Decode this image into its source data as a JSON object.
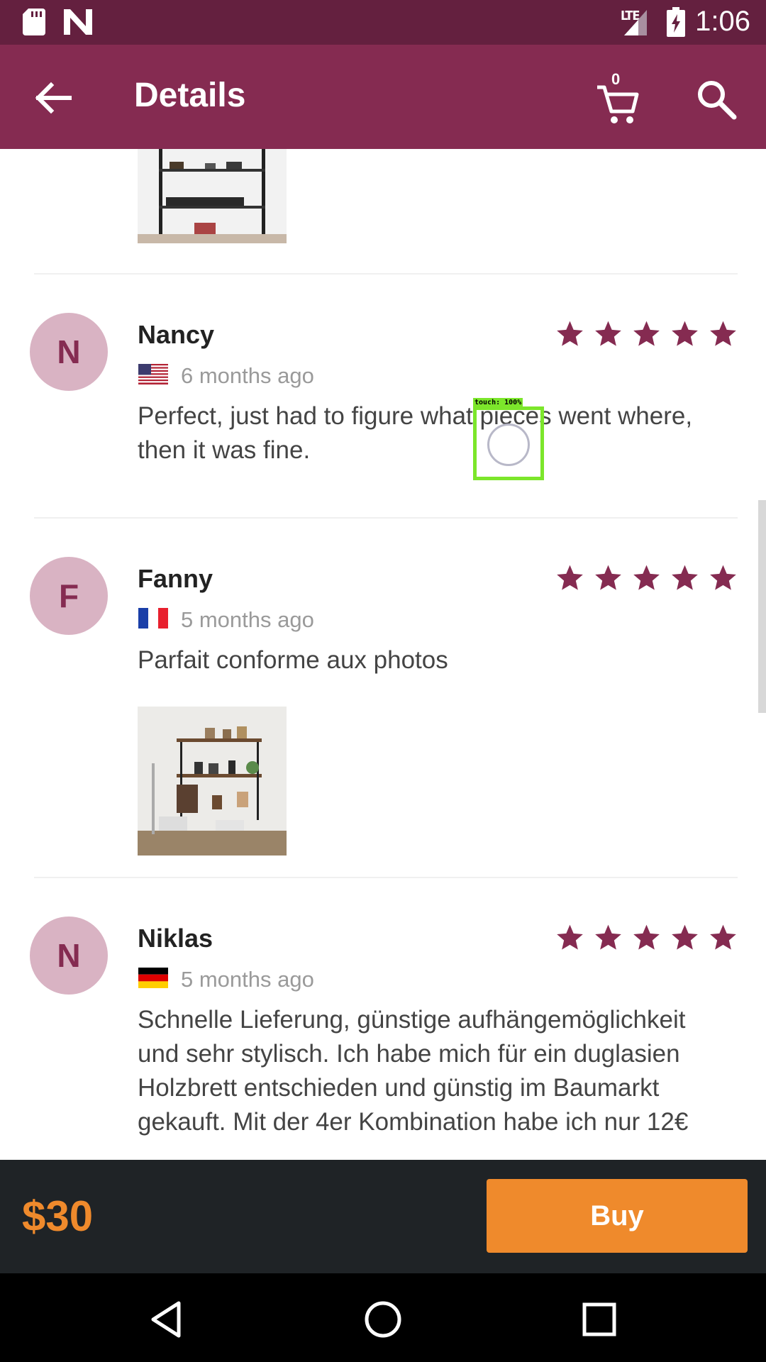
{
  "status_bar": {
    "time": "1:06",
    "network": "LTE",
    "icons": [
      "sd-card-icon",
      "n-logo-icon",
      "signal-icon",
      "battery-charging-icon"
    ]
  },
  "app_bar": {
    "title": "Details",
    "cart_count": "0",
    "icons": [
      "back-arrow-icon",
      "cart-icon",
      "search-icon"
    ]
  },
  "reviews": [
    {
      "initial": "N",
      "name": "Nancy",
      "flag": "us-flag-icon",
      "date": "6 months ago",
      "rating": 5,
      "text": "Perfect, just had to figure what pieces went where, then it was fine."
    },
    {
      "initial": "F",
      "name": "Fanny",
      "flag": "france-flag-icon",
      "date": "5 months ago",
      "rating": 5,
      "text": "Parfait conforme aux photos"
    },
    {
      "initial": "N",
      "name": "Niklas",
      "flag": "germany-flag-icon",
      "date": "5 months ago",
      "rating": 5,
      "text": "Schnelle Lieferung, günstige aufhängemöglichkeit und sehr stylisch. Ich habe mich für ein duglasien Holzbrett entschieden und günstig im Baumarkt gekauft. Mit der 4er Kombination habe ich nur 12€"
    }
  ],
  "touch_indicator": {
    "label": "touch: 100%"
  },
  "buy_bar": {
    "price": "$30",
    "buy_label": "Buy"
  },
  "colors": {
    "status_bar": "#64203f",
    "app_bar": "#852b51",
    "star": "#852b51",
    "avatar_bg": "#d9b3c3",
    "accent_orange": "#ef8a2c",
    "buy_bar_bg": "#1f2326"
  },
  "nav_bar": {
    "icons": [
      "back-triangle-icon",
      "home-circle-icon",
      "recents-square-icon"
    ]
  }
}
